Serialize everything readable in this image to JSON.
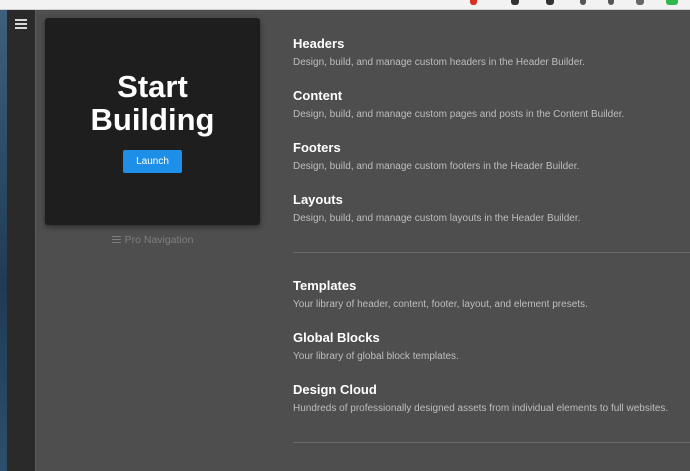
{
  "hero": {
    "title": "Start\nBuilding",
    "launch_label": "Launch"
  },
  "pro_navigation": {
    "label": "Pro Navigation"
  },
  "builders": [
    {
      "title": "Headers",
      "desc": "Design, build, and manage custom headers in the Header Builder."
    },
    {
      "title": "Content",
      "desc": "Design, build, and manage custom pages and posts in the Content Builder."
    },
    {
      "title": "Footers",
      "desc": "Design, build, and manage custom footers in the Header Builder."
    },
    {
      "title": "Layouts",
      "desc": "Design, build, and manage custom layouts in the Header Builder."
    }
  ],
  "libraries": [
    {
      "title": "Templates",
      "desc": "Your library of header, content, footer, layout, and element presets."
    },
    {
      "title": "Global Blocks",
      "desc": "Your library of global block templates."
    },
    {
      "title": "Design Cloud",
      "desc": "Hundreds of professionally designed assets from individual elements to full websites."
    }
  ],
  "colors": {
    "accent": "#1e8fe8",
    "background": "#4e4e4e",
    "hero_bg": "#1e1e1e"
  },
  "icons": {
    "sidebar_toggle": "hamburger-menu-icon",
    "pro_navigation": "hamburger-menu-icon"
  }
}
